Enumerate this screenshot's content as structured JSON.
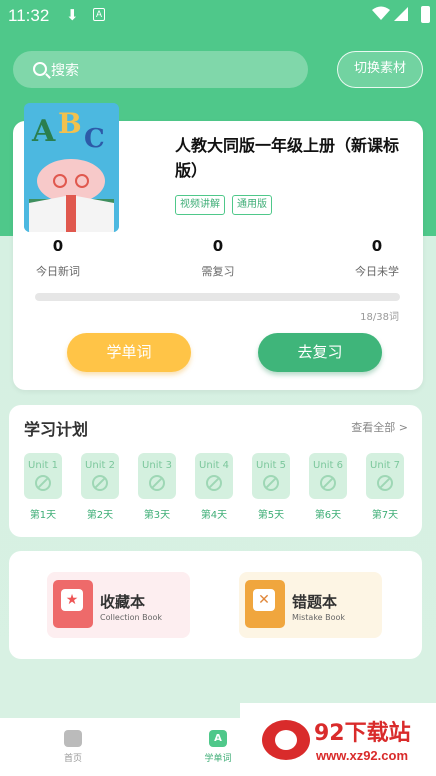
{
  "status_bar": {
    "time": "11:32"
  },
  "header": {
    "search_placeholder": "搜索",
    "switch_label": "切换素材"
  },
  "book": {
    "title": "人教大同版一年级上册（新课标版）",
    "tags": [
      "视频讲解",
      "通用版"
    ],
    "stats": [
      {
        "value": "0",
        "label": "今日新词"
      },
      {
        "value": "0",
        "label": "需复习"
      },
      {
        "value": "0",
        "label": "今日未学"
      }
    ],
    "progress_text": "18/38词",
    "progress_fraction": 0.0,
    "learn_label": "学单词",
    "review_label": "去复习"
  },
  "plan": {
    "title": "学习计划",
    "view_all": "查看全部 >",
    "units": [
      {
        "label": "Unit 1",
        "day": "第1天"
      },
      {
        "label": "Unit 2",
        "day": "第2天"
      },
      {
        "label": "Unit 3",
        "day": "第3天"
      },
      {
        "label": "Unit 4",
        "day": "第4天"
      },
      {
        "label": "Unit 5",
        "day": "第5天"
      },
      {
        "label": "Unit 6",
        "day": "第6天"
      },
      {
        "label": "Unit 7",
        "day": "第7天"
      }
    ]
  },
  "tools": {
    "collection": {
      "name": "收藏本",
      "sub": "Collection Book"
    },
    "mistake": {
      "name": "错题本",
      "sub": "Mistake Book"
    }
  },
  "tabbar": {
    "home": "首页",
    "words": "学单词"
  },
  "watermark": {
    "text": "92下载站",
    "url": "www.xz92.com"
  },
  "colors": {
    "primary": "#4fc88a",
    "accent": "#ffc447",
    "review": "#3fb57a"
  }
}
